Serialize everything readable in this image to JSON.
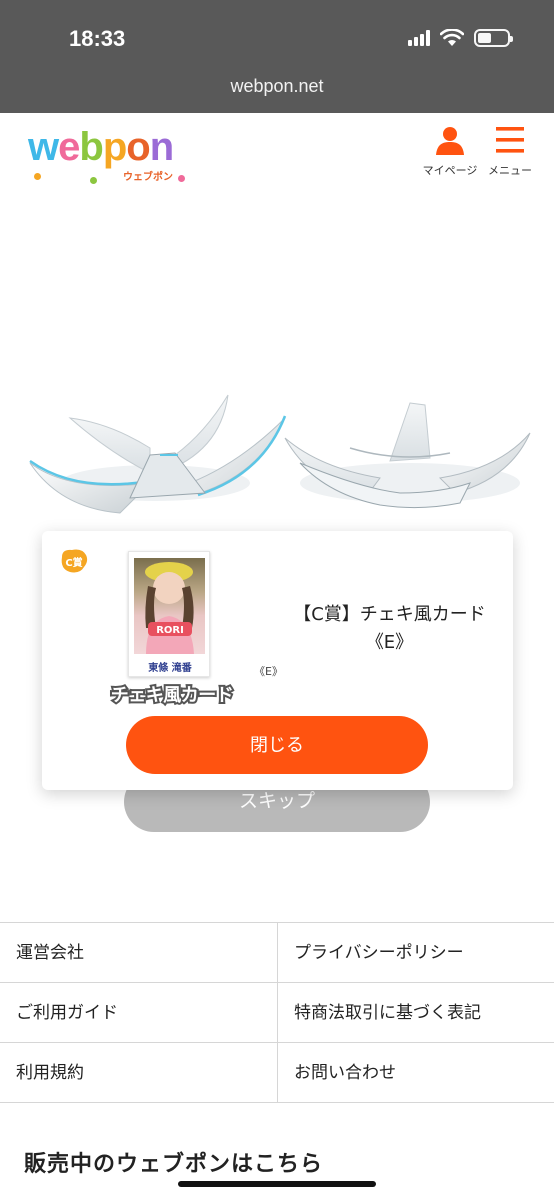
{
  "status_bar": {
    "time": "18:33",
    "battery_level": 0.45
  },
  "browser": {
    "url": "webpon.net"
  },
  "header": {
    "logo_text": "webpon",
    "logo_subtext": "ウェブポン",
    "mypage_label": "マイページ",
    "menu_label": "メニュー",
    "mypage_icon": "user-icon",
    "menu_icon": "hamburger-menu-icon",
    "accent_color": "#ff5310"
  },
  "modal": {
    "badge_text": "C賞",
    "card_caption": "東條 滝番",
    "card_shirt_text": "RORI",
    "card_name": "チェキ風カード",
    "variant_small": "《E》",
    "prize_title_line1": "【C賞】チェキ風カード",
    "prize_title_line2": "《E》",
    "close_label": "閉じる"
  },
  "skip_label": "スキップ",
  "footer": {
    "links": [
      [
        "運営会社",
        "プライバシーポリシー"
      ],
      [
        "ご利用ガイド",
        "特商法取引に基づく表記"
      ],
      [
        "利用規約",
        "お問い合わせ"
      ]
    ]
  },
  "sale_heading": "販売中のウェブポンはこちら"
}
